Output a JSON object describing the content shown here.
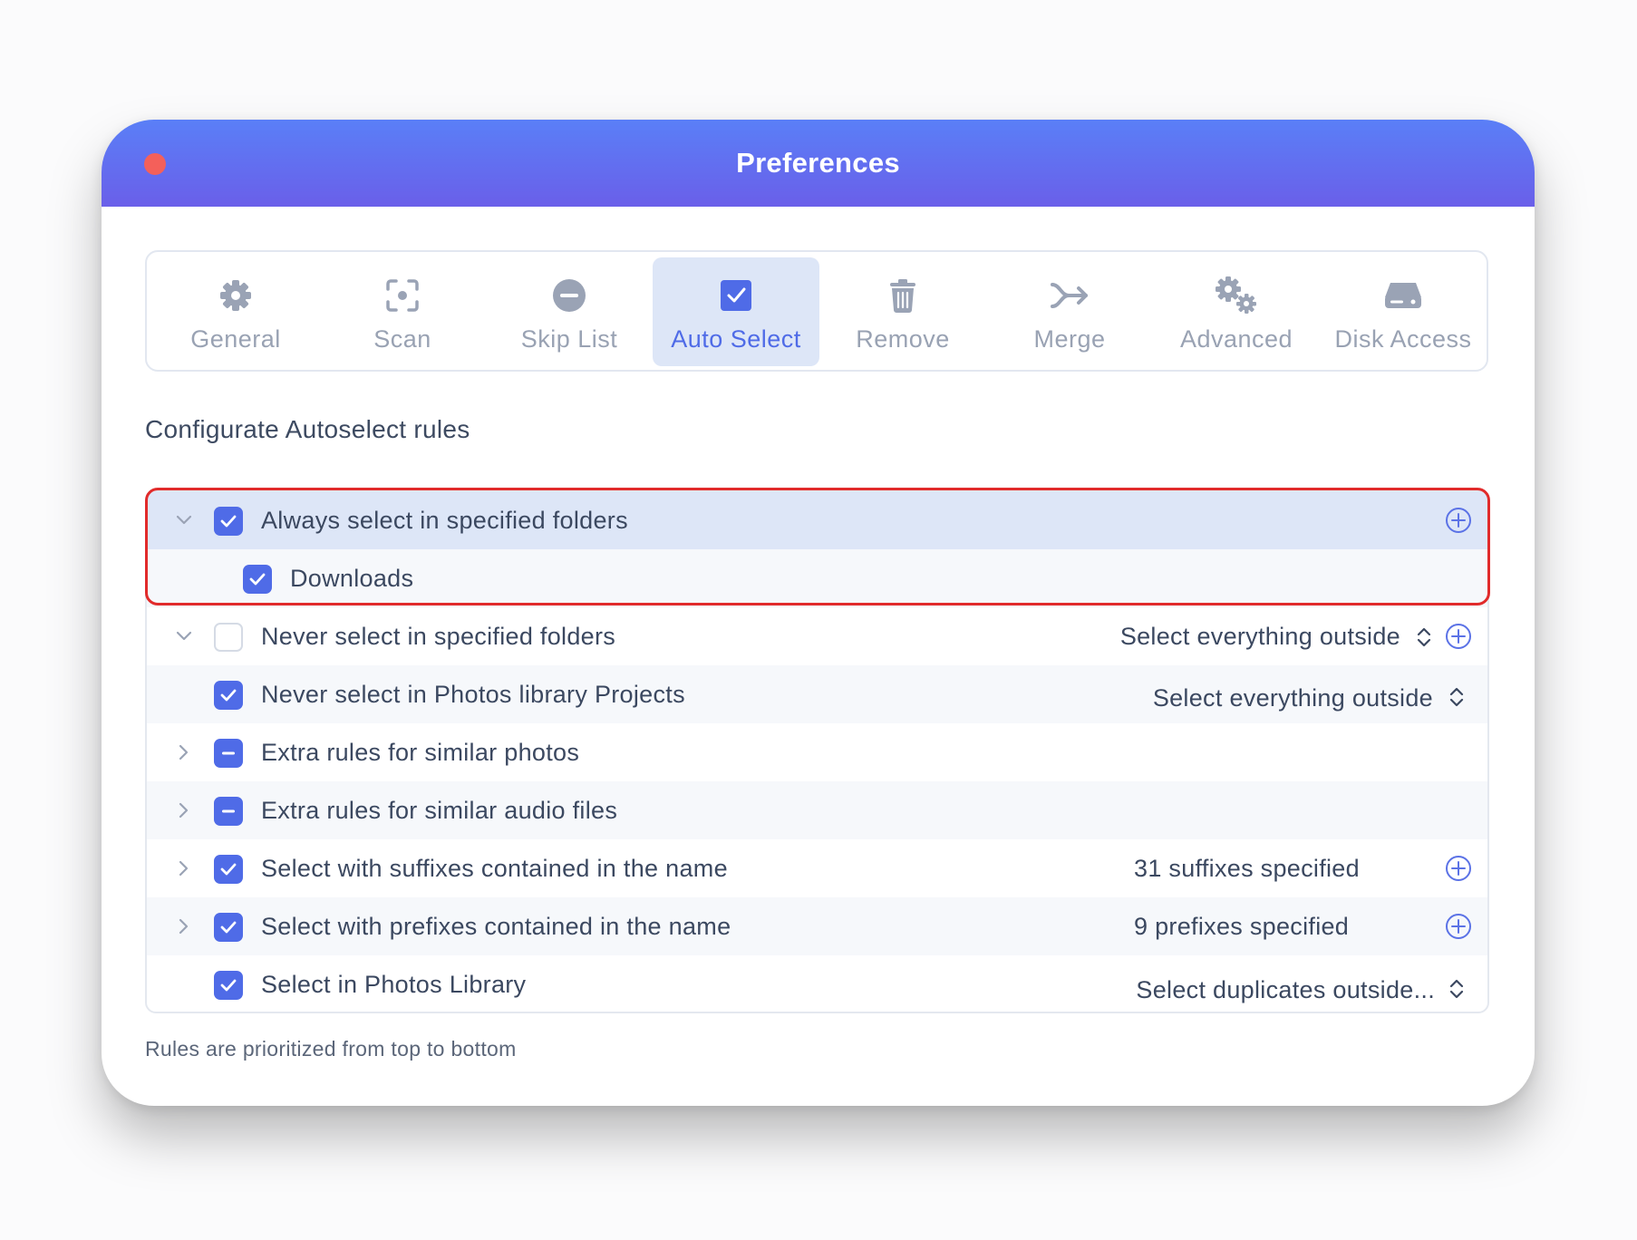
{
  "window": {
    "title": "Preferences"
  },
  "tabs": [
    {
      "label": "General",
      "icon": "gear-icon"
    },
    {
      "label": "Scan",
      "icon": "scan-icon"
    },
    {
      "label": "Skip List",
      "icon": "minus-circle-icon"
    },
    {
      "label": "Auto Select",
      "icon": "checkbox-icon",
      "active": true
    },
    {
      "label": "Remove",
      "icon": "trash-icon"
    },
    {
      "label": "Merge",
      "icon": "merge-icon"
    },
    {
      "label": "Advanced",
      "icon": "gears-icon"
    },
    {
      "label": "Disk Access",
      "icon": "disk-icon"
    }
  ],
  "section_title": "Configurate Autoselect rules",
  "rules": [
    {
      "label": "Always select in specified folders",
      "expanded": true,
      "state": "checked"
    },
    {
      "label": "Downloads",
      "state": "checked"
    },
    {
      "label": "Never select in specified folders",
      "expanded": true,
      "state": "unchecked",
      "value": "Select everything outside"
    },
    {
      "label": "Never select in Photos library Projects",
      "state": "checked",
      "value": "Select everything outside"
    },
    {
      "label": "Extra rules for similar photos",
      "expanded": false,
      "state": "mixed"
    },
    {
      "label": "Extra rules for similar audio files",
      "expanded": false,
      "state": "mixed"
    },
    {
      "label": "Select with suffixes contained in the name",
      "expanded": false,
      "state": "checked",
      "value": "31 suffixes specified"
    },
    {
      "label": "Select with prefixes contained in the name",
      "expanded": false,
      "state": "checked",
      "value": "9 prefixes specified"
    },
    {
      "label": "Select in Photos Library",
      "state": "checked",
      "value": "Select duplicates outside..."
    }
  ],
  "footer": "Rules are prioritized from top to bottom",
  "colors": {
    "accent": "#4f6be7",
    "highlight_border": "#e12b2b",
    "title_gradient_start": "#5a7ff7",
    "title_gradient_end": "#6a5fe9"
  }
}
